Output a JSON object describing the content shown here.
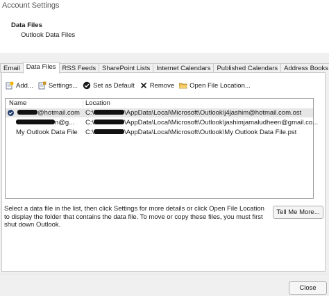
{
  "window": {
    "title": "Account Settings"
  },
  "header": {
    "title": "Data Files",
    "subtitle": "Outlook Data Files"
  },
  "tabs": [
    {
      "label": "Email",
      "active": false
    },
    {
      "label": "Data Files",
      "active": true
    },
    {
      "label": "RSS Feeds",
      "active": false
    },
    {
      "label": "SharePoint Lists",
      "active": false
    },
    {
      "label": "Internet Calendars",
      "active": false
    },
    {
      "label": "Published Calendars",
      "active": false
    },
    {
      "label": "Address Books",
      "active": false
    }
  ],
  "toolbar": {
    "add_label": "Add...",
    "settings_label": "Settings...",
    "default_label": "Set as Default",
    "remove_label": "Remove",
    "open_location_label": "Open File Location..."
  },
  "list": {
    "columns": {
      "name": "Name",
      "location": "Location"
    },
    "rows": [
      {
        "name": "@hotmail.com",
        "location_prefix": "C:\\",
        "location_suffix": "\\AppData\\Local\\Microsoft\\Outlook\\j4jashim@hotmail.com.ost",
        "default": true
      },
      {
        "name": "n@g...",
        "location_prefix": "C:\\",
        "location_suffix": "\\AppData\\Local\\Microsoft\\Outlook\\jashimjamaludheen@gmail.co...",
        "default": false
      },
      {
        "name": "My Outlook Data File",
        "location_prefix": "C:\\",
        "location_suffix": "\\AppData\\Local\\Microsoft\\Outlook\\My Outlook Data File.pst",
        "default": false
      }
    ]
  },
  "info_text": "Select a data file in the list, then click Settings for more details or click Open File Location to display the folder that contains the data file. To move or copy these files, you must first shut down Outlook.",
  "buttons": {
    "tell_me_more": "Tell Me More...",
    "close": "Close"
  },
  "icons": {
    "add": "add-icon",
    "settings": "settings-icon",
    "default": "check-circle-icon",
    "remove": "remove-x-icon",
    "open_location": "folder-icon"
  },
  "colors": {
    "accent": "#1f3b6b",
    "selection": "#e6e6e6",
    "dialog_bg": "#f0f0f0"
  }
}
